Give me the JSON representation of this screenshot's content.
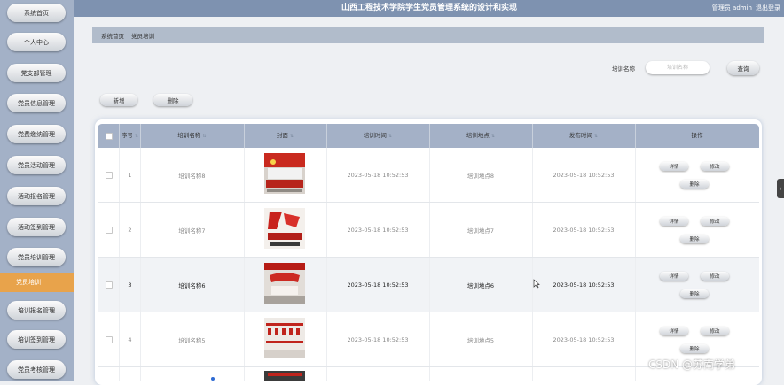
{
  "sidebar": {
    "items": [
      {
        "label": "系统首页"
      },
      {
        "label": "个人中心"
      },
      {
        "label": "党支部管理"
      },
      {
        "label": "党员信息管理"
      },
      {
        "label": "党费缴纳管理"
      },
      {
        "label": "党员活动管理"
      },
      {
        "label": "活动报名管理"
      },
      {
        "label": "活动签到管理"
      },
      {
        "label": "党员培训管理"
      },
      {
        "label": "党员培训"
      },
      {
        "label": "培训报名管理"
      },
      {
        "label": "培训签到管理"
      },
      {
        "label": "党员考核管理"
      }
    ],
    "active_index": 9
  },
  "header": {
    "title": "山西工程技术学院学生党员管理系统的设计和实现",
    "user": "管理员 admin",
    "logout": "退出登录"
  },
  "breadcrumb": {
    "home": "系统首页",
    "separator": "",
    "current": "党员培训"
  },
  "search": {
    "label": "培训名称",
    "placeholder": "培训名称",
    "button": "查询"
  },
  "toolbar": {
    "add": "新增",
    "delete": "删除"
  },
  "table": {
    "columns": [
      "序号",
      "培训名称",
      "封面",
      "培训时间",
      "培训地点",
      "发布时间",
      "操作"
    ],
    "rows": [
      {
        "no": "1",
        "name": "培训名称8",
        "time": "2023-05-18 10:52:53",
        "place": "培训地点8",
        "publish": "2023-05-18 10:52:53"
      },
      {
        "no": "2",
        "name": "培训名称7",
        "time": "2023-05-18 10:52:53",
        "place": "培训地点7",
        "publish": "2023-05-18 10:52:53"
      },
      {
        "no": "3",
        "name": "培训名称6",
        "time": "2023-05-18 10:52:53",
        "place": "培训地点6",
        "publish": "2023-05-18 10:52:53"
      },
      {
        "no": "4",
        "name": "培训名称5",
        "time": "2023-05-18 10:52:53",
        "place": "培训地点5",
        "publish": "2023-05-18 10:52:53"
      }
    ],
    "actions": {
      "detail": "详情",
      "edit": "修改",
      "delete": "删除"
    }
  },
  "side_tab_icon": "chevron-left-icon",
  "watermark": "CSDN @苏南学弟",
  "colors": {
    "sidebar": "#a3b1c7",
    "header": "#7e92b0",
    "active": "#e8a34b",
    "table_head": "#a4b1c7"
  }
}
